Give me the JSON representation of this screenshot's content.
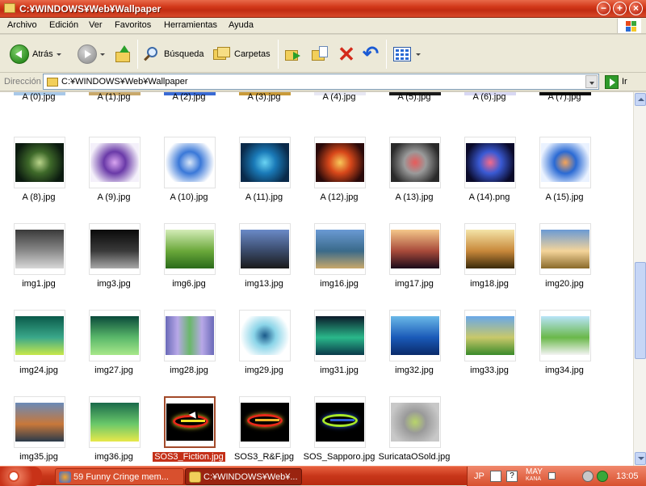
{
  "window": {
    "title": "C:¥WINDOWS¥Web¥Wallpaper"
  },
  "menu": [
    "Archivo",
    "Edición",
    "Ver",
    "Favoritos",
    "Herramientas",
    "Ayuda"
  ],
  "toolbar": {
    "back_label": "Atrás",
    "search_label": "Búsqueda",
    "folders_label": "Carpetas"
  },
  "address": {
    "label": "Dirección",
    "value": "C:¥WINDOWS¥Web¥Wallpaper",
    "go_label": "Ir"
  },
  "files_row0": [
    "A (0).jpg",
    "A (1).jpg",
    "A (2).jpg",
    "A (3).jpg",
    "A (4).jpg",
    "A (5).jpg",
    "A (6).jpg",
    "A (7).jpg"
  ],
  "files": [
    {
      "name": "A (8).jpg",
      "colors": [
        "#0b1a0f",
        "#3f6a2a",
        "#b9d48a"
      ],
      "kind": "radial"
    },
    {
      "name": "A (9).jpg",
      "colors": [
        "#f4f0fa",
        "#6a3aa8",
        "#d8a4f0"
      ],
      "kind": "radial"
    },
    {
      "name": "A (10).jpg",
      "colors": [
        "#ffffff",
        "#3a78d8",
        "#d8e6f8"
      ],
      "kind": "radial"
    },
    {
      "name": "A (11).jpg",
      "colors": [
        "#0a2a4a",
        "#1a7ab8",
        "#6ad4f4"
      ],
      "kind": "radial"
    },
    {
      "name": "A (12).jpg",
      "colors": [
        "#2a0a0a",
        "#d8481a",
        "#f8c85a"
      ],
      "kind": "radial"
    },
    {
      "name": "A (13).jpg",
      "colors": [
        "#2a2a2a",
        "#9a9a9a",
        "#e85a5a"
      ],
      "kind": "radial"
    },
    {
      "name": "A (14).png",
      "colors": [
        "#0a0a2a",
        "#3a5ad4",
        "#f46a8a"
      ],
      "kind": "radial"
    },
    {
      "name": "A (15).jpg",
      "colors": [
        "#eaf2ff",
        "#2a6ad4",
        "#f4a45a"
      ],
      "kind": "radial"
    },
    {
      "name": "img1.jpg",
      "colors": [
        "#3a3a3a",
        "#8a8a8a",
        "#d8d8d8"
      ],
      "kind": "linear"
    },
    {
      "name": "img3.jpg",
      "colors": [
        "#0a0a0a",
        "#3a3a3a",
        "#a8a8a8"
      ],
      "kind": "linear"
    },
    {
      "name": "img6.jpg",
      "colors": [
        "#d4ecb8",
        "#6aa83a",
        "#2a6a1a"
      ],
      "kind": "linear"
    },
    {
      "name": "img13.jpg",
      "colors": [
        "#6a8ac8",
        "#3a4a6a",
        "#1a1a1a"
      ],
      "kind": "linear"
    },
    {
      "name": "img16.jpg",
      "colors": [
        "#6a9ad4",
        "#3a6a8a",
        "#c8a86a"
      ],
      "kind": "linear"
    },
    {
      "name": "img17.jpg",
      "colors": [
        "#f4c88a",
        "#a84a3a",
        "#1a0a1a"
      ],
      "kind": "linear"
    },
    {
      "name": "img18.jpg",
      "colors": [
        "#f4e4a8",
        "#c8883a",
        "#3a2a0a"
      ],
      "kind": "linear"
    },
    {
      "name": "img20.jpg",
      "colors": [
        "#6a9ad4",
        "#f4d49a",
        "#8a6a2a"
      ],
      "kind": "linear"
    },
    {
      "name": "img24.jpg",
      "colors": [
        "#0a5a4a",
        "#3aa88a",
        "#c8e84a"
      ],
      "kind": "linear"
    },
    {
      "name": "img27.jpg",
      "colors": [
        "#0a4a3a",
        "#5ab86a",
        "#a8e88a"
      ],
      "kind": "linear"
    },
    {
      "name": "img28.jpg",
      "colors": [
        "#6a6ab8",
        "#b8a8e8",
        "#6ab86a"
      ],
      "kind": "stripes"
    },
    {
      "name": "img29.jpg",
      "colors": [
        "#ffffff",
        "#8ad4e8",
        "#1a5a8a"
      ],
      "kind": "radial"
    },
    {
      "name": "img31.jpg",
      "colors": [
        "#0a1a2a",
        "#2ab88a",
        "#0a3a4a"
      ],
      "kind": "linear"
    },
    {
      "name": "img32.jpg",
      "colors": [
        "#6ab8e8",
        "#1a5ab8",
        "#0a2a6a"
      ],
      "kind": "linear"
    },
    {
      "name": "img33.jpg",
      "colors": [
        "#6aa8e8",
        "#c8c86a",
        "#3a8a2a"
      ],
      "kind": "linear"
    },
    {
      "name": "img34.jpg",
      "colors": [
        "#b8e4f8",
        "#6ab84a",
        "#f4f4f4"
      ],
      "kind": "linear"
    },
    {
      "name": "img35.jpg",
      "colors": [
        "#6a8ab8",
        "#c8783a",
        "#2a3a4a"
      ],
      "kind": "linear"
    },
    {
      "name": "img36.jpg",
      "colors": [
        "#1a6a4a",
        "#6ac86a",
        "#e8e84a"
      ],
      "kind": "linear"
    },
    {
      "name": "SOS3_Fiction.jpg",
      "colors": [
        "#000000",
        "#e82a1a",
        "#f4e42a"
      ],
      "kind": "logo",
      "selected": true
    },
    {
      "name": "SOS3_R&F.jpg",
      "colors": [
        "#000000",
        "#e82a1a",
        "#f4b42a"
      ],
      "kind": "logo"
    },
    {
      "name": "SOS_Sapporo.jpg",
      "colors": [
        "#000000",
        "#a8e82a",
        "#2a5ad4"
      ],
      "kind": "logo"
    },
    {
      "name": "SuricataOSold.jpg",
      "colors": [
        "#c8c8c8",
        "#9a9a9a",
        "#b8d46a"
      ],
      "kind": "radial"
    }
  ],
  "taskbar": {
    "items": [
      "59 Funny Cringe mem...",
      "C:¥WINDOWS¥Web¥..."
    ],
    "lang": "JP",
    "ime_top": "MAY",
    "ime_bottom": "KANA",
    "clock": "13:05"
  },
  "colors": {
    "title_bar": "#d2381a",
    "selection": "#c43018",
    "taskbar": "#c8361a"
  }
}
